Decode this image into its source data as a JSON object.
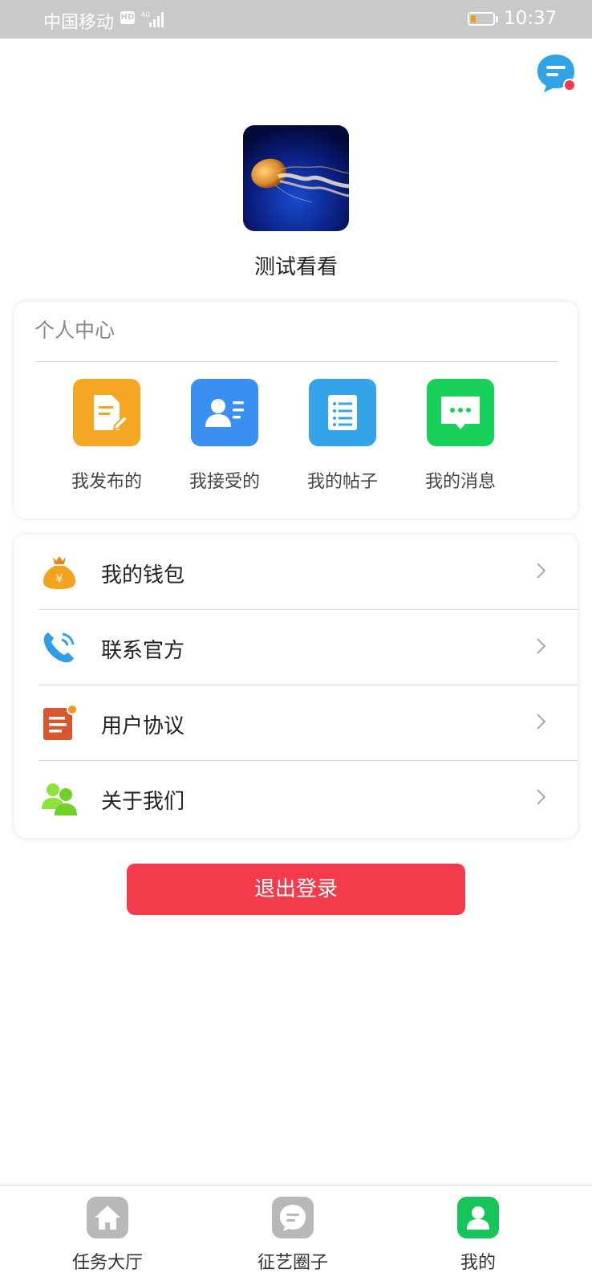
{
  "status_bar": {
    "carrier": "中国移动",
    "hd": "HD",
    "network": "4G",
    "time": "10:37",
    "battery_color": "#f19a20"
  },
  "profile": {
    "username": "测试看看"
  },
  "personal_center": {
    "title": "个人中心",
    "items": [
      {
        "label": "我发布的",
        "icon": "edit-document-icon",
        "color": "#f5a623"
      },
      {
        "label": "我接受的",
        "icon": "contact-card-icon",
        "color": "#3b8ef2"
      },
      {
        "label": "我的帖子",
        "icon": "list-icon",
        "color": "#35a3e8"
      },
      {
        "label": "我的消息",
        "icon": "message-icon",
        "color": "#18d05a"
      }
    ]
  },
  "menu": [
    {
      "label": "我的钱包",
      "icon": "money-bag-icon"
    },
    {
      "label": "联系官方",
      "icon": "phone-icon"
    },
    {
      "label": "用户协议",
      "icon": "agreement-icon"
    },
    {
      "label": "关于我们",
      "icon": "users-icon"
    }
  ],
  "logout_label": "退出登录",
  "logout_color": "#f43b4c",
  "bottom_nav": [
    {
      "label": "任务大厅",
      "icon": "home-icon",
      "active": false
    },
    {
      "label": "征艺圈子",
      "icon": "chat-icon",
      "active": false
    },
    {
      "label": "我的",
      "icon": "user-icon",
      "active": true
    }
  ],
  "colors": {
    "active_tab": "#16c45a",
    "inactive_tab": "#b8b8b8"
  }
}
